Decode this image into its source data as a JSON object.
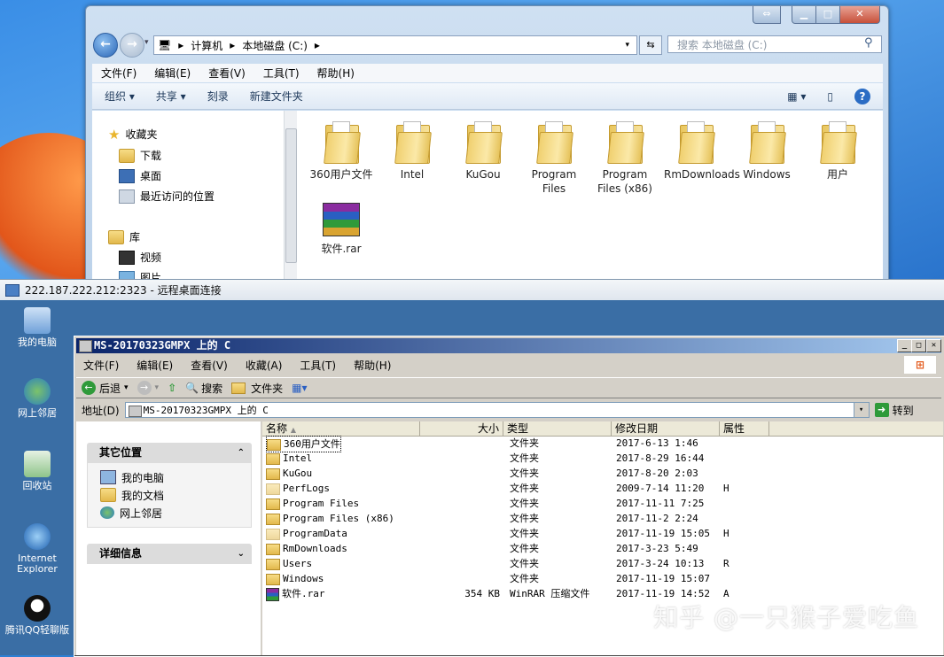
{
  "win7": {
    "address": [
      "计算机",
      "本地磁盘 (C:)"
    ],
    "search_placeholder": "搜索 本地磁盘 (C:)",
    "menu": [
      "文件(F)",
      "编辑(E)",
      "查看(V)",
      "工具(T)",
      "帮助(H)"
    ],
    "commands": [
      "组织 ▾",
      "共享 ▾",
      "刻录",
      "新建文件夹"
    ],
    "nav": {
      "favorites": "收藏夹",
      "downloads": "下载",
      "desktop": "桌面",
      "recent": "最近访问的位置",
      "libraries": "库",
      "videos": "视频",
      "pictures": "图片"
    },
    "files": [
      {
        "name": "360用户文件"
      },
      {
        "name": "Intel"
      },
      {
        "name": "KuGou"
      },
      {
        "name": "Program Files"
      },
      {
        "name": "Program Files (x86)"
      },
      {
        "name": "RmDownloads"
      },
      {
        "name": "Windows"
      },
      {
        "name": "用户"
      },
      {
        "name": "软件.rar",
        "type": "rar"
      }
    ]
  },
  "rdp": {
    "title": "222.187.222.212:2323 - 远程桌面连接"
  },
  "desktop_icons": [
    "我的电脑",
    "网上邻居",
    "回收站",
    "Internet Explorer",
    "腾讯QQ轻聊版"
  ],
  "xp": {
    "title": "MS-20170323GMPX 上的 C",
    "menu": [
      "文件(F)",
      "编辑(E)",
      "查看(V)",
      "收藏(A)",
      "工具(T)",
      "帮助(H)"
    ],
    "toolbar": {
      "back": "后退",
      "search": "搜索",
      "folders": "文件夹"
    },
    "address_label": "地址(D)",
    "address": "MS-20170323GMPX 上的 C",
    "go": "转到",
    "other_places_title": "其它位置",
    "other_places": [
      "我的电脑",
      "我的文档",
      "网上邻居"
    ],
    "details_title": "详细信息",
    "columns": [
      "名称",
      "大小",
      "类型",
      "修改日期",
      "属性"
    ],
    "rows": [
      {
        "name": "360用户文件",
        "size": "",
        "type": "文件夹",
        "date": "2017-6-13 1:46",
        "attr": ""
      },
      {
        "name": "Intel",
        "size": "",
        "type": "文件夹",
        "date": "2017-8-29 16:44",
        "attr": ""
      },
      {
        "name": "KuGou",
        "size": "",
        "type": "文件夹",
        "date": "2017-8-20 2:03",
        "attr": ""
      },
      {
        "name": "PerfLogs",
        "size": "",
        "type": "文件夹",
        "date": "2009-7-14 11:20",
        "attr": "H"
      },
      {
        "name": "Program Files",
        "size": "",
        "type": "文件夹",
        "date": "2017-11-11 7:25",
        "attr": ""
      },
      {
        "name": "Program Files (x86)",
        "size": "",
        "type": "文件夹",
        "date": "2017-11-2 2:24",
        "attr": ""
      },
      {
        "name": "ProgramData",
        "size": "",
        "type": "文件夹",
        "date": "2017-11-19 15:05",
        "attr": "H"
      },
      {
        "name": "RmDownloads",
        "size": "",
        "type": "文件夹",
        "date": "2017-3-23 5:49",
        "attr": ""
      },
      {
        "name": "Users",
        "size": "",
        "type": "文件夹",
        "date": "2017-3-24 10:13",
        "attr": "R"
      },
      {
        "name": "Windows",
        "size": "",
        "type": "文件夹",
        "date": "2017-11-19 15:07",
        "attr": ""
      },
      {
        "name": "软件.rar",
        "size": "354 KB",
        "type": "WinRAR 压缩文件",
        "date": "2017-11-19 14:52",
        "attr": "A"
      }
    ]
  },
  "watermark": "知乎 @一只猴子爱吃鱼"
}
